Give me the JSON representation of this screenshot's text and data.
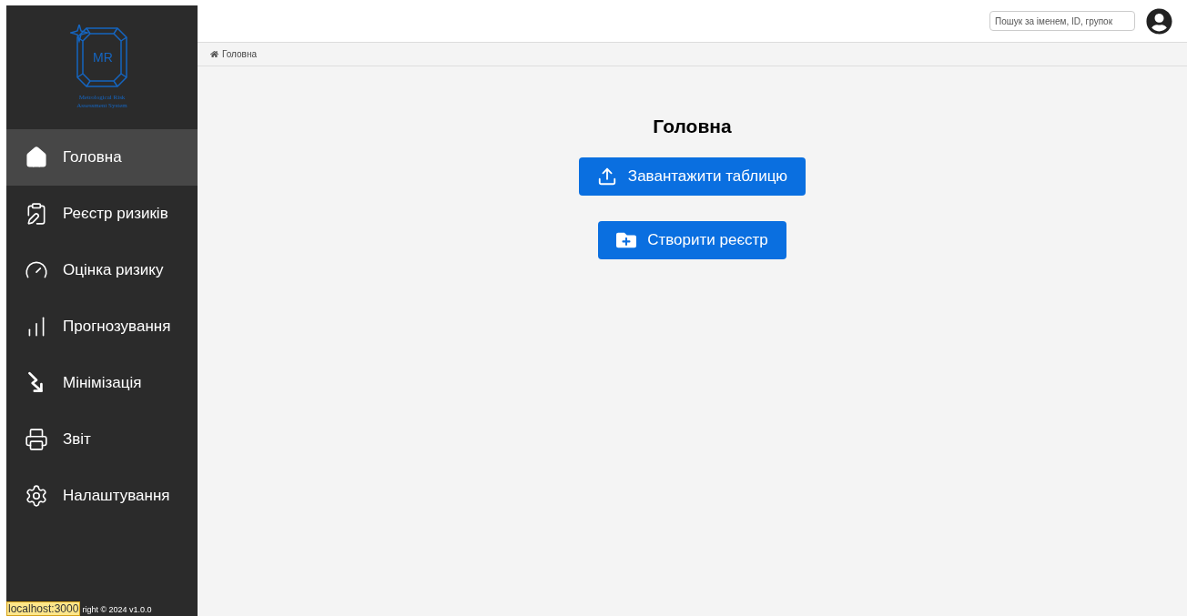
{
  "logo": {
    "monogram": "MR",
    "caption": "Metrological Risk Assessment System"
  },
  "sidebar": {
    "items": [
      {
        "label": "Головна",
        "kind": "home",
        "selected": true
      },
      {
        "label": "Реєстр ризиків",
        "kind": "register",
        "selected": false
      },
      {
        "label": "Оцінка ризику",
        "kind": "assessment",
        "selected": false
      },
      {
        "label": "Прогнозування",
        "kind": "forecast",
        "selected": false
      },
      {
        "label": "Мінімізація",
        "kind": "minimization",
        "selected": false
      },
      {
        "label": "Звіт",
        "kind": "report",
        "selected": false
      },
      {
        "label": "Налаштування",
        "kind": "settings",
        "selected": false
      }
    ],
    "footer": "right © 2024 v1.0.0",
    "status_tooltip": "localhost:3000"
  },
  "header": {
    "search": {
      "placeholder": "Пошук за іменем, ID, групок"
    }
  },
  "breadcrumb": [
    "Головна"
  ],
  "main": {
    "title": "Головна",
    "buttons": [
      {
        "label": "Завантажити таблицю",
        "kind": "upload"
      },
      {
        "label": "Створити реєстр",
        "kind": "create"
      }
    ]
  }
}
